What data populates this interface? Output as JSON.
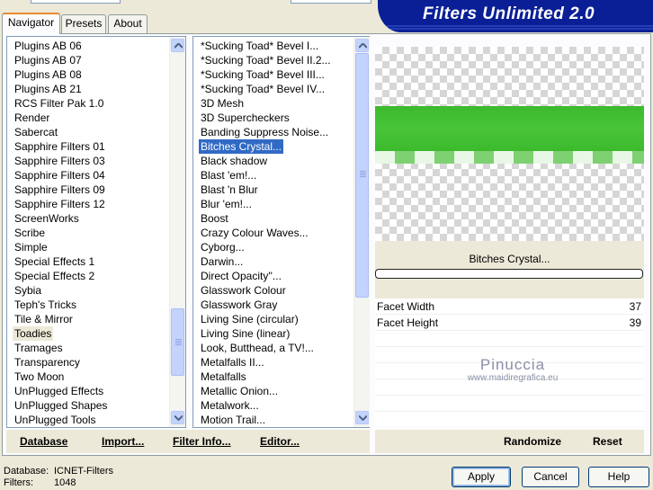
{
  "tabs": [
    {
      "label": "Navigator",
      "active": true
    },
    {
      "label": "Presets",
      "active": false
    },
    {
      "label": "About",
      "active": false
    }
  ],
  "title": "Filters Unlimited 2.0",
  "categories": {
    "items": [
      "Plugins AB 06",
      "Plugins AB 07",
      "Plugins AB 08",
      "Plugins AB 21",
      "RCS Filter Pak 1.0",
      "Render",
      "Sabercat",
      "Sapphire Filters 01",
      "Sapphire Filters 03",
      "Sapphire Filters 04",
      "Sapphire Filters 09",
      "Sapphire Filters 12",
      "ScreenWorks",
      "Scribe",
      "Simple",
      "Special Effects 1",
      "Special Effects 2",
      "Sybia",
      "Teph's Tricks",
      "Tile & Mirror",
      "Toadies",
      "Tramages",
      "Transparency",
      "Two Moon",
      "UnPlugged Effects",
      "UnPlugged Shapes",
      "UnPlugged Tools"
    ],
    "selected": "Toadies",
    "scroll_position": 0.88
  },
  "filters": {
    "items": [
      "*Sucking Toad*  Bevel I...",
      "*Sucking Toad*  Bevel II.2...",
      "*Sucking Toad*  Bevel III...",
      "*Sucking Toad*  Bevel IV...",
      "3D Mesh",
      "3D Supercheckers",
      "Banding Suppress Noise...",
      "Bitches Crystal...",
      "Black shadow",
      "Blast 'em!...",
      "Blast 'n Blur",
      "Blur 'em!...",
      "Boost",
      "Crazy Colour Waves...",
      "Cyborg...",
      "Darwin...",
      "Direct Opacity''...",
      "Glasswork Colour",
      "Glasswork Gray",
      "Living Sine (circular)",
      "Living Sine (linear)",
      "Look, Butthead, a TV!...",
      "Metalfalls II...",
      "Metalfalls",
      "Metallic Onion...",
      "Metalwork...",
      "Motion Trail..."
    ],
    "selected": "Bitches Crystal...",
    "scroll_position": 0.0
  },
  "bottom_links": {
    "database": "Database",
    "import": "Import...",
    "filter_info": "Filter Info...",
    "editor": "Editor...",
    "randomize": "Randomize",
    "reset": "Reset"
  },
  "preview": {
    "filter_name": "Bitches Crystal...",
    "band_color": "#3cba2c",
    "watermark_name": "Pinuccia",
    "watermark_url": "www.maidiregrafica.eu"
  },
  "parameters": [
    {
      "name": "Facet Width",
      "value": "37"
    },
    {
      "name": "Facet Height",
      "value": "39"
    }
  ],
  "status": {
    "database_label": "Database:",
    "database_value": "ICNET-Filters",
    "filters_label": "Filters:",
    "filters_value": "1048"
  },
  "buttons": {
    "apply": "Apply",
    "cancel": "Cancel",
    "help": "Help"
  },
  "colors": {
    "banner": "#0a1f95",
    "selection": "#316ac5",
    "tab_accent": "#e68b2c"
  }
}
